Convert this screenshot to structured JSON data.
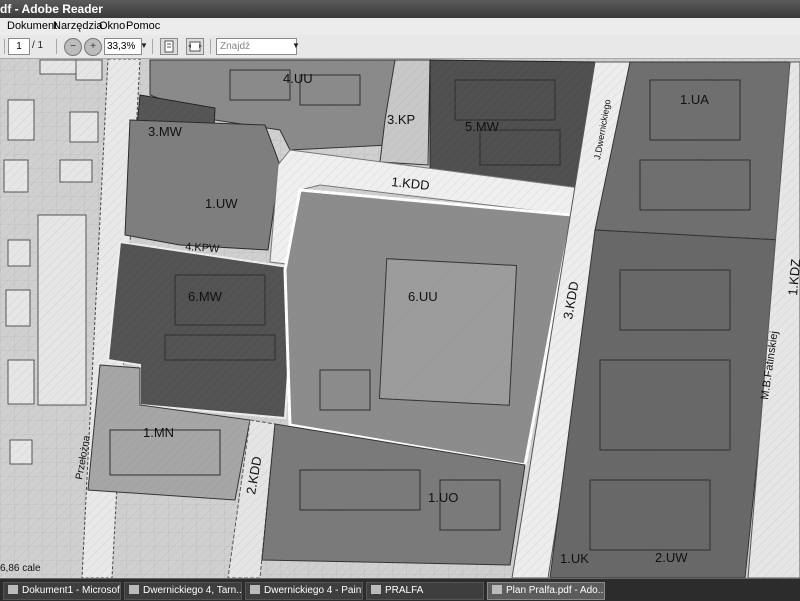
{
  "window": {
    "title": "df - Adobe Reader"
  },
  "menu": {
    "items": [
      "Dokument",
      "Narzędzia",
      "Okno",
      "Pomoc"
    ]
  },
  "toolbar": {
    "page_current": "1",
    "page_total": "/ 1",
    "zoom": "33,3%",
    "search_placeholder": "Znajdź"
  },
  "map": {
    "zones": {
      "z4uu": "4.UU",
      "z3mw": "3.MW",
      "z3kp": "3.KP",
      "z5mw": "5.MW",
      "z1ua": "1.UA",
      "z1kdd": "1.KDD",
      "z1uw": "1.UW",
      "z4kpw": "4.KPW",
      "z6mw": "6.MW",
      "z6uu": "6.UU",
      "z3kdd": "3.KDD",
      "z1mn": "1.MN",
      "z2kdd": "2.KDD",
      "z1uo": "1.UO",
      "z2uw": "2.UW",
      "z1kdz": "1.KDZ",
      "z1uk": "1.UK"
    },
    "streets": {
      "dwernickiego": "J.Dwernickiego",
      "fatinskiej": "M.B.Fatinskiej",
      "przelozna": "Przełożna"
    }
  },
  "status": {
    "page_size": "6,86 cale"
  },
  "taskbar": {
    "items": [
      "Dokument1 - Microsof...",
      "Dwernickiego 4, Tarn...",
      "Dwernickiego 4 - Paint",
      "PRALFA",
      "Plan Pralfa.pdf - Ado..."
    ]
  }
}
